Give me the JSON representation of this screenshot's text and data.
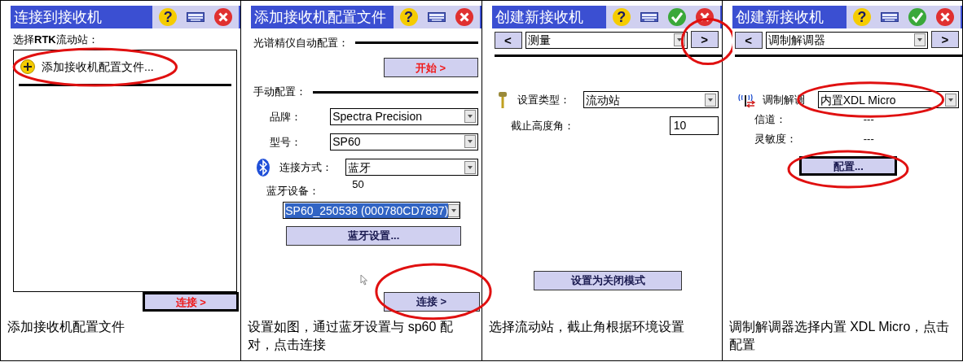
{
  "panels": [
    {
      "title": "连接到接收机",
      "title_buttons": [
        {
          "kind": "help",
          "glyph": "?"
        },
        {
          "kind": "keyboard"
        },
        {
          "kind": "close"
        }
      ],
      "body": [
        {
          "kind": "label",
          "text": "选择**RTK**流动站："
        },
        {
          "kind": "listbox",
          "items": [
            {
              "text": "添加接收机配置文件...",
              "circled": true
            }
          ]
        },
        {
          "kind": "footer_button",
          "text": "连接 >",
          "accent": true,
          "default": true
        }
      ],
      "caption": "添加接收机配置文件"
    },
    {
      "title": "添加接收机配置文件",
      "title_buttons": [
        {
          "kind": "help",
          "glyph": "?"
        },
        {
          "kind": "keyboard"
        },
        {
          "kind": "close"
        }
      ],
      "body": [
        {
          "kind": "section",
          "text": "光谱精仪自动配置："
        },
        {
          "kind": "action_button",
          "text": "开始 >",
          "accent": true,
          "default": false
        },
        {
          "kind": "section",
          "text": "手动配置："
        },
        {
          "kind": "dropdown_field",
          "label": "品牌：",
          "value": "Spectra Precision"
        },
        {
          "kind": "dropdown_field",
          "label": "型号：",
          "value": "SP60"
        },
        {
          "kind": "dropdown_field",
          "label": "连接方式：",
          "value": "蓝牙"
        },
        {
          "kind": "label",
          "text": "蓝牙设备：",
          "note": "50"
        },
        {
          "kind": "dropdown",
          "value": "SP60_250538 (000780CD7897)",
          "selected": true
        },
        {
          "kind": "wide_button",
          "text": "蓝牙设置...",
          "accent": false,
          "default": false
        },
        {
          "kind": "footer_button",
          "text": "连接 >",
          "accent": false,
          "default": false,
          "circled": true
        }
      ],
      "caption": "设置如图，通过蓝牙设置与 sp60 配对，点击连接"
    },
    {
      "title": "创建新接收机",
      "title_buttons": [
        {
          "kind": "help",
          "glyph": "?"
        },
        {
          "kind": "keyboard"
        },
        {
          "kind": "ok"
        },
        {
          "kind": "close"
        }
      ],
      "body": [
        {
          "kind": "nav",
          "prev": "<",
          "page": "测量",
          "next": ">",
          "next_circled": true
        },
        {
          "kind": "dropdown_field",
          "label": "设置类型：",
          "value": "流动站"
        },
        {
          "kind": "text_field",
          "label": "截止高度角：",
          "value": "10"
        },
        {
          "kind": "mode_button",
          "text": "设置为关闭模式",
          "accent": false,
          "default": false
        }
      ],
      "caption": "选择流动站，截止角根据环境设置"
    },
    {
      "title": "创建新接收机",
      "title_buttons": [
        {
          "kind": "help",
          "glyph": "?"
        },
        {
          "kind": "keyboard"
        },
        {
          "kind": "ok"
        },
        {
          "kind": "close"
        }
      ],
      "body": [
        {
          "kind": "nav",
          "prev": "<",
          "page": "调制解调器",
          "next": ">"
        },
        {
          "kind": "dropdown_field",
          "label": "调制解调",
          "value": "内置XDL Micro",
          "circled": true
        },
        {
          "kind": "readout",
          "label": "信道：",
          "value": "---"
        },
        {
          "kind": "readout",
          "label": "灵敏度：",
          "value": "---"
        },
        {
          "kind": "center_button",
          "text": "配置...",
          "accent": false,
          "default": true,
          "circled": true
        }
      ],
      "caption": "调制解调器选择内置 XDL Micro，点击配置"
    }
  ]
}
